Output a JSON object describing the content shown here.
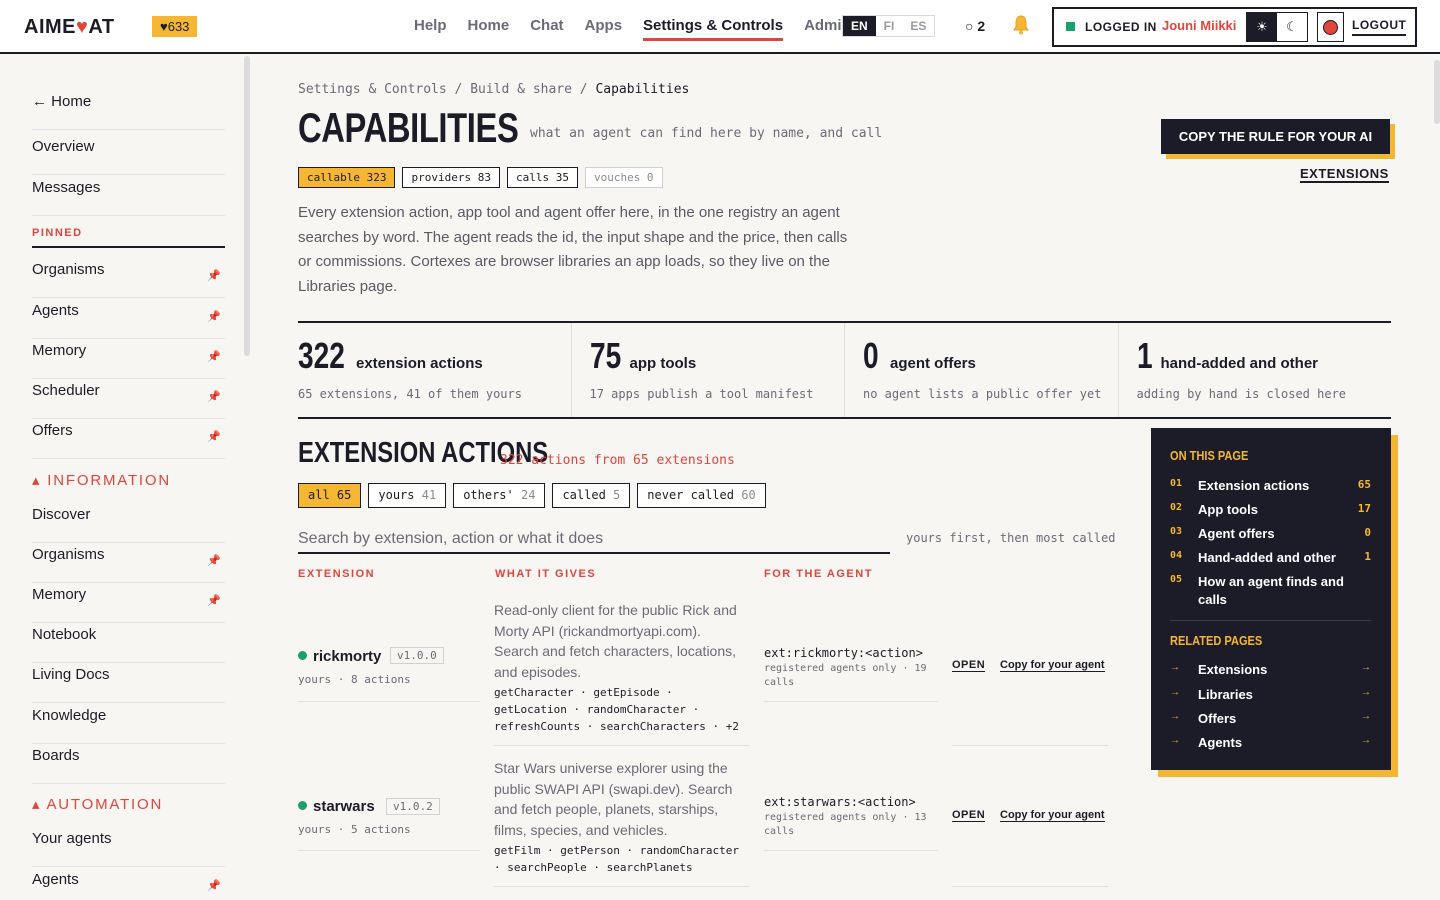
{
  "topbar": {
    "logo_left": "AIME",
    "logo_heart": "♥",
    "logo_right": "AT",
    "karma": "♥633",
    "nav": [
      "Help",
      "Home",
      "Chat",
      "Apps",
      "Settings & Controls",
      "Admin"
    ],
    "active_nav": "Settings & Controls",
    "langs": [
      "EN",
      "FI",
      "ES"
    ],
    "active_lang": "EN",
    "ring_count": "○ 2",
    "logged_in": "LOGGED IN",
    "user_name": "Jouni Miikki",
    "theme_light": "☀",
    "theme_dark": "☾",
    "logout": "LOGOUT"
  },
  "sidebar": {
    "home": "← Home",
    "overview": "Overview",
    "messages": "Messages",
    "pinned_head": "PINNED",
    "pinned": [
      "Organisms",
      "Agents",
      "Memory",
      "Scheduler",
      "Offers"
    ],
    "info_head": "▴ INFORMATION",
    "info": [
      "Discover",
      "Organisms",
      "Memory",
      "Notebook",
      "Living Docs",
      "Knowledge",
      "Boards"
    ],
    "auto_head": "▴ AUTOMATION",
    "auto": [
      "Your agents",
      "Agents"
    ],
    "pin_icon": "📌"
  },
  "breadcrumb": {
    "a": "Settings & Controls",
    "sep1": "/",
    "b": "Build & share",
    "sep2": "/",
    "c": "Capabilities"
  },
  "page": {
    "title": "CAPABILITIES",
    "subtitle": "what an agent can find here by name, and call",
    "copy_rule": "COPY THE RULE FOR YOUR AI",
    "extensions_link": "EXTENSIONS",
    "chips": [
      "callable 323",
      "providers 83",
      "calls 35",
      "vouches 0"
    ],
    "intro": "Every extension action, app tool and agent offer here, in the one registry an agent searches by word. The agent reads the id, the input shape and the price, then calls or commissions. Cortexes are browser libraries an app loads, so they live on the Libraries page."
  },
  "stats": [
    {
      "num": "322",
      "label": "extension actions",
      "sub": "65 extensions, 41 of them yours"
    },
    {
      "num": "75",
      "label": "app tools",
      "sub": "17 apps publish a tool manifest"
    },
    {
      "num": "0",
      "label": "agent offers",
      "sub": "no agent lists a public offer yet"
    },
    {
      "num": "1",
      "label": "hand-added and other",
      "sub": "adding by hand is closed here"
    }
  ],
  "section": {
    "title": "EXTENSION ACTIONS",
    "sub": "322 actions from 65 extensions",
    "filters": [
      {
        "label": "all",
        "count": "65"
      },
      {
        "label": "yours",
        "count": "41"
      },
      {
        "label": "others'",
        "count": "24"
      },
      {
        "label": "called",
        "count": "5"
      },
      {
        "label": "never called",
        "count": "60"
      }
    ],
    "search_placeholder": "Search by extension, action or what it does",
    "sort_note": "yours first, then most called",
    "col_extension": "EXTENSION",
    "col_gives": "WHAT IT GIVES",
    "col_agent": "FOR THE AGENT"
  },
  "rows": [
    {
      "name": "rickmorty",
      "version": "v1.0.0",
      "meta": "yours · 8 actions",
      "desc": "Read-only client for the public Rick and Morty API (rickandmortyapi.com). Search and fetch characters, locations, and episodes.",
      "actions": "getCharacter · getEpisode · getLocation · randomCharacter · refreshCounts · searchCharacters · +2",
      "call": "ext:rickmorty:<action>",
      "call_sub": "registered agents only · 19 calls",
      "open": "OPEN",
      "copy": "Copy for your agent"
    },
    {
      "name": "starwars",
      "version": "v1.0.2",
      "meta": "yours · 5 actions",
      "desc": "Star Wars universe explorer using the public SWAPI API (swapi.dev). Search and fetch people, planets, starships, films, species, and vehicles.",
      "actions": "getFilm · getPerson · randomCharacter · searchPeople · searchPlanets",
      "call": "ext:starwars:<action>",
      "call_sub": "registered agents only · 13 calls",
      "open": "OPEN",
      "copy": "Copy for your agent"
    }
  ],
  "toc": {
    "head": "ON THIS PAGE",
    "items": [
      {
        "n": "01",
        "t": "Extension actions",
        "c": "65"
      },
      {
        "n": "02",
        "t": "App tools",
        "c": "17"
      },
      {
        "n": "03",
        "t": "Agent offers",
        "c": "0"
      },
      {
        "n": "04",
        "t": "Hand-added and other",
        "c": "1"
      },
      {
        "n": "05",
        "t": "How an agent finds and calls",
        "c": ""
      }
    ],
    "related_head": "RELATED PAGES",
    "related": [
      "Extensions",
      "Libraries",
      "Offers",
      "Agents"
    ],
    "arrow": "→"
  },
  "colors": {
    "accent_red": "#e0463c",
    "accent_yellow": "#f5b731",
    "ink": "#1c1c28",
    "status_green": "#1aa06d"
  }
}
